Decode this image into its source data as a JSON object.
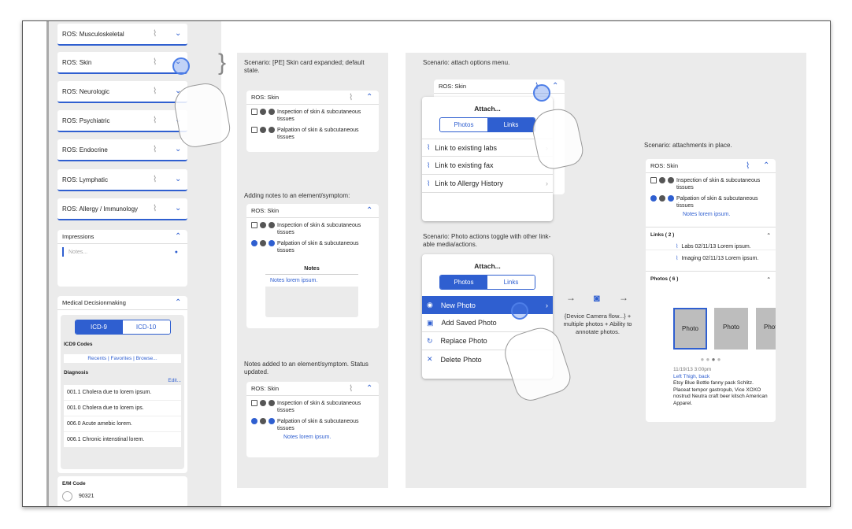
{
  "left": {
    "ros_cards": [
      "ROS: Musculoskeletal",
      "ROS: Skin",
      "ROS: Neurologic",
      "ROS: Psychiatric",
      "ROS: Endocrine",
      "ROS: Lymphatic",
      "ROS: Allergy / Immunology"
    ],
    "impressions": {
      "title": "Impressions",
      "placeholder": "Notes..."
    },
    "mdm": {
      "title": "Medical Decisionmaking",
      "tab_on": "ICD-9",
      "tab_off": "ICD-10",
      "codes_label": "ICD9 Codes",
      "links": [
        "Recents",
        "|",
        "Favorites",
        "|",
        "Browse..."
      ],
      "diagnosis_label": "Diagnosis",
      "edit": "Edit...",
      "items": [
        "001.1 Cholera due to lorem ipsum.",
        "001.0 Cholera due to lorem ips.",
        "006.0 Acute amebic lorem.",
        "006.1 Chronic intenstinal lorem."
      ]
    },
    "em": {
      "title": "E/M Code",
      "value": "90321"
    }
  },
  "mid": {
    "cap1": "Scenario: [PE] Skin card expanded; default state.",
    "card_title": "ROS: Skin",
    "row1": "Inspection of skin & subcutaneous tissues",
    "row2": "Palpation of skin & subcutaneous tissues",
    "cap2": "Adding notes to an element/symptom:",
    "notes_title": "Notes",
    "notes_text": "Notes lorem ipsum.",
    "cap3": "Notes added to an element/symptom. Status updated."
  },
  "right": {
    "cap1": "Scenario: attach options menu.",
    "card_title": "ROS: Skin",
    "attach": "Attach...",
    "tab_photos": "Photos",
    "tab_links": "Links",
    "links_menu": [
      "Link to existing labs",
      "Link to existing fax",
      "Link to Allergy History"
    ],
    "cap2": "Scenario: Photo actions toggle with other link-able media/actions.",
    "photo_menu": [
      "New Photo",
      "Add Saved Photo",
      "Replace Photo",
      "Delete Photo"
    ],
    "camera_note": "{Device Camera flow...} + multiple photos + Ability to annotate photos.",
    "cap3": "Scenario: attachments in place.",
    "row1": "Inspection of skin & subcutaneous tissues",
    "row2": "Palpation of skin & subcutaneous tissues",
    "notes": "Notes lorem ipsum.",
    "links_hd": "Links ( 2 )",
    "link_items": [
      "Labs  02/11/13  Lorem ipsum.",
      "Imaging  02/11/13  Lorem ipsum."
    ],
    "photos_hd": "Photos ( 6 )",
    "photo_label": "Photo",
    "photo_date": "11/19/13  3:00pm",
    "photo_loc": "Left Thigh, back",
    "photo_desc": "Etsy Blue Bottle fanny pack Schlitz. Placeat tempor gastropub, Vice XOXO nostrud Neutra craft beer kitsch American Apparel."
  },
  "colors": {
    "accent": "#2f5fd0",
    "panel": "#ebebeb"
  }
}
